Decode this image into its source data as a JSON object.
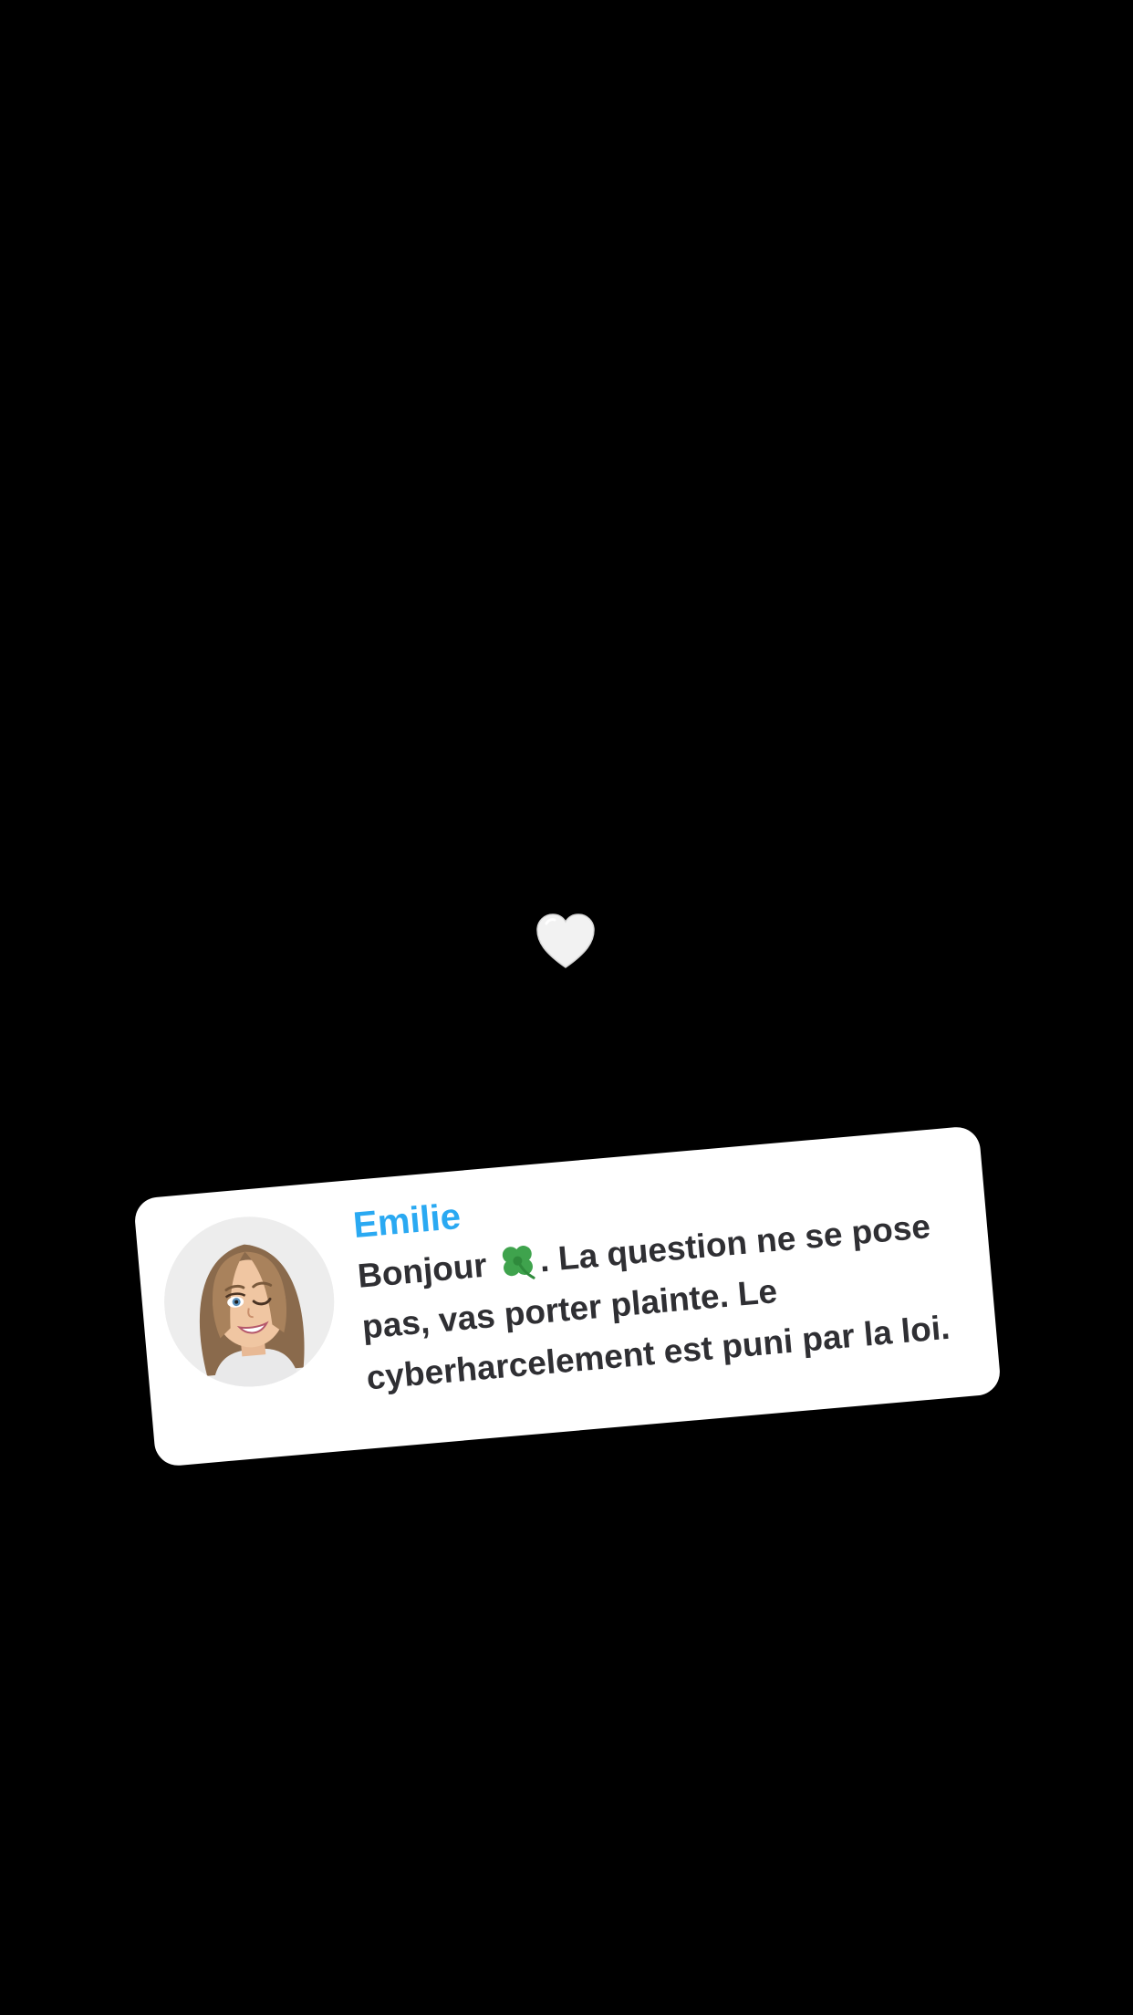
{
  "background_color": "#000000",
  "heart": {
    "icon": "white-heart-icon",
    "color": "#f2f2f2"
  },
  "reply_card": {
    "author": "Emilie",
    "author_color": "#2aa9f2",
    "avatar_icon": "bitmoji-avatar-icon",
    "message_before_emoji": "Bonjour ",
    "emoji_icon": "four-leaf-clover-icon",
    "message_after_emoji": ". La question ne se pose pas, vas porter plainte. Le cyberharcelement est puni par la loi."
  }
}
